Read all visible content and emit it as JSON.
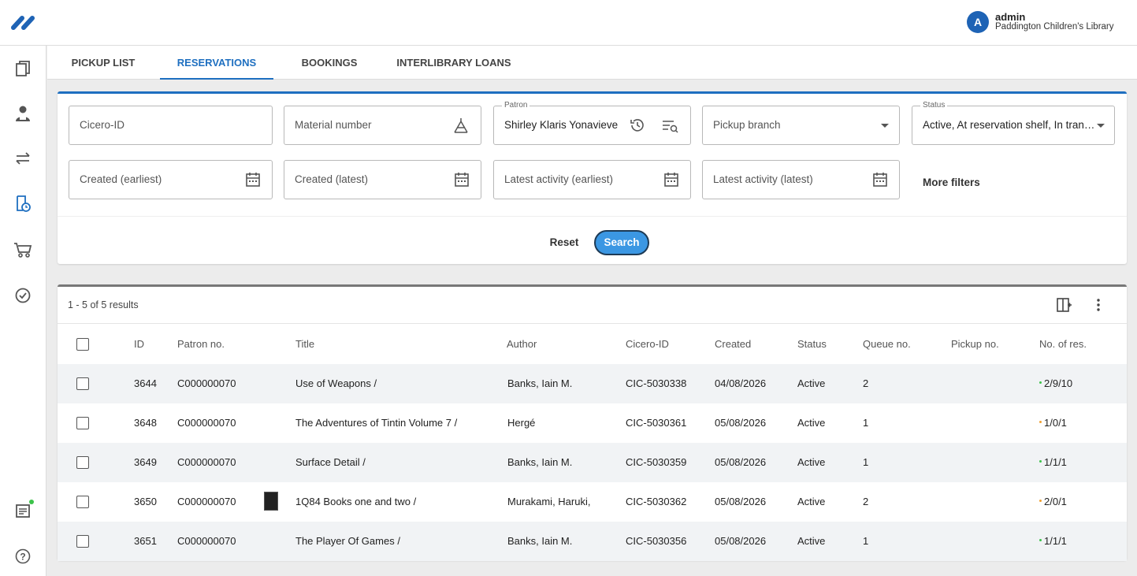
{
  "header": {
    "user_initial": "A",
    "user_name": "admin",
    "user_org": "Paddington Children's Library"
  },
  "sidebar": {
    "items": [
      {
        "name": "catalogue-icon"
      },
      {
        "name": "patrons-icon"
      },
      {
        "name": "circulation-icon"
      },
      {
        "name": "reservations-icon",
        "active": true
      },
      {
        "name": "acquisitions-icon"
      },
      {
        "name": "tasks-icon"
      },
      {
        "name": "reports-icon"
      },
      {
        "name": "help-icon"
      }
    ]
  },
  "tabs": [
    {
      "label": "PICKUP LIST"
    },
    {
      "label": "RESERVATIONS",
      "active": true
    },
    {
      "label": "BOOKINGS"
    },
    {
      "label": "INTERLIBRARY LOANS"
    }
  ],
  "filters": {
    "cicero_id": {
      "placeholder": "Cicero-ID"
    },
    "material_number": {
      "placeholder": "Material number"
    },
    "patron": {
      "label": "Patron",
      "value": "Shirley Klaris Yonavieve Ec"
    },
    "pickup_branch": {
      "placeholder": "Pickup branch"
    },
    "status": {
      "label": "Status",
      "value": "Active, At reservation shelf, In transit,..."
    },
    "created_earliest": {
      "placeholder": "Created (earliest)"
    },
    "created_latest": {
      "placeholder": "Created (latest)"
    },
    "activity_earliest": {
      "placeholder": "Latest activity (earliest)"
    },
    "activity_latest": {
      "placeholder": "Latest activity (latest)"
    },
    "more_filters": "More filters",
    "reset": "Reset",
    "search": "Search"
  },
  "results": {
    "count": "1 - 5 of 5 results",
    "columns": [
      "ID",
      "Patron no.",
      "Title",
      "Author",
      "Cicero-ID",
      "Created",
      "Status",
      "Queue no.",
      "Pickup no.",
      "No. of res."
    ],
    "rows": [
      {
        "id": "3644",
        "patron": "C000000070",
        "title": "Use of Weapons /",
        "author": "Banks, Iain M.",
        "cicero": "CIC-5030338",
        "created": "04/08/2026",
        "status": "Active",
        "queue": "2",
        "pickup": "",
        "nres": "2/9/10",
        "dot_color": "#3cc34a",
        "cover": false
      },
      {
        "id": "3648",
        "patron": "C000000070",
        "title": "The Adventures of Tintin Volume 7 /",
        "author": "Hergé",
        "cicero": "CIC-5030361",
        "created": "05/08/2026",
        "status": "Active",
        "queue": "1",
        "pickup": "",
        "nres": "1/0/1",
        "dot_color": "#f0a030",
        "cover": false
      },
      {
        "id": "3649",
        "patron": "C000000070",
        "title": "Surface Detail /",
        "author": "Banks, Iain M.",
        "cicero": "CIC-5030359",
        "created": "05/08/2026",
        "status": "Active",
        "queue": "1",
        "pickup": "",
        "nres": "1/1/1",
        "dot_color": "#3cc34a",
        "cover": false
      },
      {
        "id": "3650",
        "patron": "C000000070",
        "title": "1Q84 Books one and two /",
        "author": "Murakami, Haruki,",
        "cicero": "CIC-5030362",
        "created": "05/08/2026",
        "status": "Active",
        "queue": "2",
        "pickup": "",
        "nres": "2/0/1",
        "dot_color": "#f0a030",
        "cover": true
      },
      {
        "id": "3651",
        "patron": "C000000070",
        "title": "The Player Of Games /",
        "author": "Banks, Iain M.",
        "cicero": "CIC-5030356",
        "created": "05/08/2026",
        "status": "Active",
        "queue": "1",
        "pickup": "",
        "nres": "1/1/1",
        "dot_color": "#3cc34a",
        "cover": false
      }
    ]
  },
  "colors": {
    "accent": "#1e6fc0",
    "search_button": "#3b97e3",
    "avatar": "#1e63b5",
    "status_ok": "#3cc34a",
    "status_warn": "#f0a030"
  }
}
